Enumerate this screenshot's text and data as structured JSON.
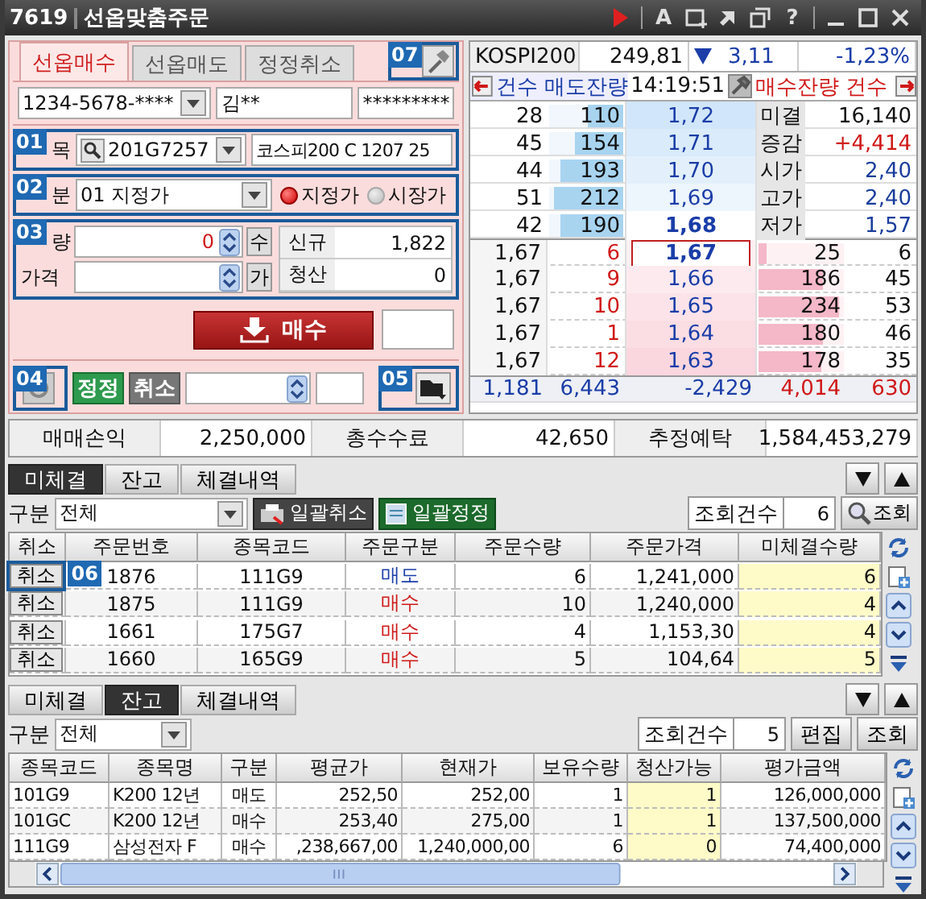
{
  "window": {
    "number": "7619",
    "title": "선옵맞춤주문"
  },
  "toolbar": [
    {
      "kind": "play"
    },
    {
      "kind": "separator"
    },
    {
      "kind": "text",
      "label": "A"
    },
    {
      "kind": "new-window"
    },
    {
      "kind": "arrow"
    },
    {
      "kind": "restore"
    },
    {
      "kind": "text",
      "label": "?"
    },
    {
      "kind": "separator"
    },
    {
      "kind": "minimize"
    },
    {
      "kind": "maximize"
    },
    {
      "kind": "close"
    }
  ],
  "order_panel": {
    "tabs": [
      {
        "label": "선옵매수",
        "selected": true
      },
      {
        "label": "선옵매도",
        "selected": false
      },
      {
        "label": "정정취소",
        "selected": false
      }
    ],
    "tool_callout": "07",
    "account": {
      "number": "1234-5678-****",
      "name": "김**",
      "password": "*********"
    },
    "symbol_row": {
      "callout": "01",
      "label": "목",
      "code": "201G7257",
      "name": "코스피200 C 1207 25"
    },
    "type_row": {
      "callout": "02",
      "label": "분",
      "value": "01 지정가",
      "options": [
        {
          "label": "지정가",
          "selected": true
        },
        {
          "label": "시장가",
          "selected": false
        }
      ]
    },
    "qty_block": {
      "callout": "03",
      "qty_label": "량",
      "qty": "0",
      "qty_unit": "수",
      "price_label": "가격",
      "price_unit": "가",
      "new_label": "신규",
      "new_value": "1,822",
      "close_label": "청산",
      "close_value": "0"
    },
    "buy_button": "매수",
    "bottom": {
      "refresh_callout": "04",
      "modify": "정정",
      "cancel": "취소",
      "folder_callout": "05"
    }
  },
  "quote": {
    "index": {
      "name": "KOSPI200",
      "value": "249,81",
      "falling": true,
      "change": "3,11",
      "rate": "-1,23%"
    },
    "header": {
      "ask_title": "건수 매도잔량",
      "time": "14:19:51",
      "bid_title": "매수잔량 건수"
    },
    "asks": [
      {
        "count": "28",
        "qty": "110",
        "level": 0.48,
        "price": "1,72",
        "label": "미결",
        "value": "16,140",
        "kind": "plain"
      },
      {
        "count": "45",
        "qty": "154",
        "level": 0.66,
        "price": "1,71",
        "label": "증감",
        "value": "+4,414",
        "kind": "up"
      },
      {
        "count": "44",
        "qty": "193",
        "level": 0.85,
        "price": "1,70",
        "label": "시가",
        "value": "2,40",
        "kind": "price"
      },
      {
        "count": "51",
        "qty": "212",
        "level": 0.93,
        "price": "1,69",
        "label": "고가",
        "value": "2,40",
        "kind": "price"
      },
      {
        "count": "42",
        "qty": "190",
        "level": 0.85,
        "price": "1,68",
        "label": "저가",
        "value": "1,57",
        "kind": "price"
      }
    ],
    "bids": [
      {
        "trade_price": "1,67",
        "trade_qty": "6",
        "price": "1,67",
        "selected": true,
        "qty": "25",
        "level": 0.09,
        "count": "6"
      },
      {
        "trade_price": "1,67",
        "trade_qty": "9",
        "price": "1,66",
        "selected": false,
        "qty": "186",
        "level": 0.75,
        "count": "45"
      },
      {
        "trade_price": "1,67",
        "trade_qty": "10",
        "price": "1,65",
        "selected": false,
        "qty": "234",
        "level": 0.95,
        "count": "53"
      },
      {
        "trade_price": "1,67",
        "trade_qty": "1",
        "price": "1,64",
        "selected": false,
        "qty": "180",
        "level": 0.75,
        "count": "46"
      },
      {
        "trade_price": "1,67",
        "trade_qty": "12",
        "price": "1,63",
        "selected": false,
        "qty": "178",
        "level": 0.74,
        "count": "35"
      }
    ],
    "totals": [
      "1,181",
      "6,443",
      "-2,429",
      "4,014",
      "630"
    ]
  },
  "summary": [
    {
      "label": "매매손익",
      "value": "2,250,000"
    },
    {
      "label": "총수수료",
      "value": "42,650"
    },
    {
      "label": "추정예탁",
      "value": "1,584,453,279"
    }
  ],
  "orders": {
    "tabs": [
      {
        "label": "미체결",
        "selected": true
      },
      {
        "label": "잔고",
        "selected": false
      },
      {
        "label": "체결내역",
        "selected": false
      }
    ],
    "filter_label": "구분",
    "filter": "전체",
    "buttons": [
      "일괄취소",
      "일괄정정"
    ],
    "count_label": "조회건수",
    "count": "6",
    "query": "조회",
    "callout": "06",
    "columns": [
      "취소",
      "주문번호",
      "종목코드",
      "주문구분",
      "주문수량",
      "주문가격",
      "미체결수량"
    ],
    "rows": [
      {
        "action": "취소",
        "order_no": "1876",
        "code": "111G9",
        "side": "매도",
        "kind": "sell",
        "qty": "6",
        "price": "1,241,000",
        "open": "6"
      },
      {
        "action": "취소",
        "order_no": "1875",
        "code": "111G9",
        "side": "매수",
        "kind": "buy",
        "qty": "10",
        "price": "1,240,000",
        "open": "4"
      },
      {
        "action": "취소",
        "order_no": "1661",
        "code": "175G7",
        "side": "매수",
        "kind": "buy",
        "qty": "4",
        "price": "1,153,30",
        "open": "4"
      },
      {
        "action": "취소",
        "order_no": "1660",
        "code": "165G9",
        "side": "매수",
        "kind": "buy",
        "qty": "5",
        "price": "104,64",
        "open": "5"
      }
    ]
  },
  "positions": {
    "tabs": [
      {
        "label": "미체결",
        "selected": false
      },
      {
        "label": "잔고",
        "selected": true
      },
      {
        "label": "체결내역",
        "selected": false
      }
    ],
    "filter_label": "구분",
    "filter": "전체",
    "count_label": "조회건수",
    "count": "5",
    "buttons": [
      "편집",
      "조회"
    ],
    "columns": [
      "종목코드",
      "종목명",
      "구분",
      "평균가",
      "현재가",
      "보유수량",
      "청산가능",
      "평가금액"
    ],
    "rows": [
      {
        "code": "101G9",
        "name": "K200 12년",
        "side": "매도",
        "avg": "252,50",
        "current": "252,00",
        "hold": "1",
        "closable": "1",
        "value": "126,000,000"
      },
      {
        "code": "101GC",
        "name": "K200 12년",
        "side": "매수",
        "avg": "253,40",
        "current": "275,00",
        "hold": "1",
        "closable": "1",
        "value": "137,500,000"
      },
      {
        "code": "111G9",
        "name": "삼성전자  F",
        "side": "매수",
        "avg": ",238,667,00",
        "current": "1,240,000,00",
        "hold": "6",
        "closable": "0",
        "value": "74,400,000"
      }
    ]
  }
}
